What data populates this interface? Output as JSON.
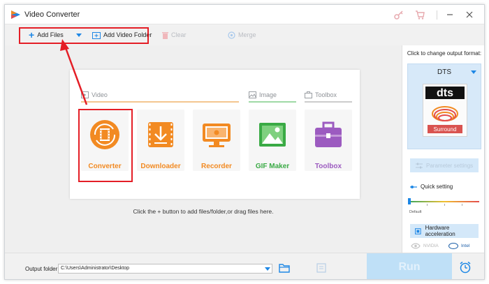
{
  "window": {
    "title": "Video Converter"
  },
  "toolbar": {
    "add_files": "Add Files",
    "add_video_folder": "Add Video Folder",
    "clear": "Clear",
    "merge": "Merge"
  },
  "categories": {
    "video": "Video",
    "image": "Image",
    "toolbox": "Toolbox"
  },
  "tools": [
    {
      "label": "Converter",
      "color": "#f28a22"
    },
    {
      "label": "Downloader",
      "color": "#f28a22"
    },
    {
      "label": "Recorder",
      "color": "#f28a22"
    },
    {
      "label": "GIF Maker",
      "color": "#3aaa45"
    },
    {
      "label": "Toolbox",
      "color": "#9c5bc0"
    }
  ],
  "hint": "Click the + button to add files/folder,or drag files here.",
  "right_panel": {
    "caption": "Click to change output format:",
    "format": "DTS",
    "logo_text": "dts",
    "logo_sub": "Surround",
    "parameter_settings": "Parameter settings",
    "quick_setting": "Quick setting",
    "default_label": "Default",
    "hardware_acceleration": "Hardware acceleration",
    "nvidia": "NVIDIA",
    "intel": "Intel"
  },
  "bottom": {
    "output_folder_label": "Output folder:",
    "output_path": "C:\\Users\\Administrator\\Desktop",
    "run": "Run"
  },
  "colors": {
    "accent": "#1d87e5",
    "highlight": "#e41e26",
    "orange": "#f28a22",
    "green": "#3aaa45",
    "purple": "#9c5bc0"
  }
}
